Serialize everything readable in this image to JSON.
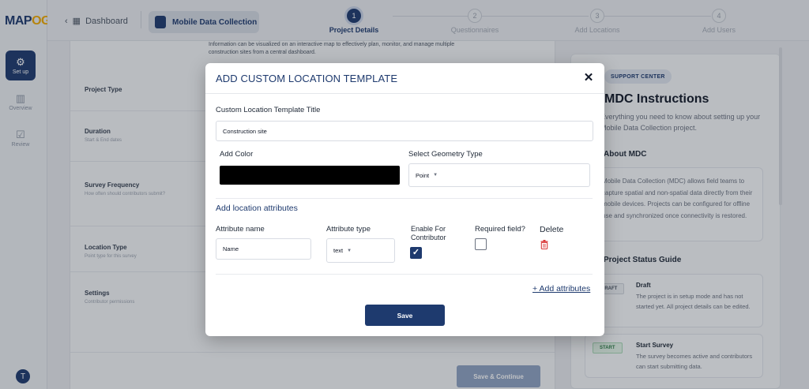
{
  "app": {
    "logo_text": "MAP",
    "logo_accent": "OG",
    "brand_color": "#1e3a6e",
    "accent_color": "#f2a900"
  },
  "rail": {
    "items": [
      {
        "label": "Set up",
        "icon": "gear-icon",
        "active": true
      },
      {
        "label": "Overview",
        "icon": "bar-chart-icon",
        "active": false
      },
      {
        "label": "Review",
        "icon": "check-square-icon",
        "active": false
      }
    ],
    "avatar_initial": "T"
  },
  "topbar": {
    "back_label": "Dashboard",
    "project_label": "Mobile Data Collection",
    "steps": [
      {
        "number": "1",
        "label": "Project Details",
        "active": true
      },
      {
        "number": "2",
        "label": "Questionnaires",
        "active": false
      },
      {
        "number": "3",
        "label": "Add Locations",
        "active": false
      },
      {
        "number": "4",
        "label": "Add Users",
        "active": false
      }
    ]
  },
  "main": {
    "description_line1": "Information can be visualized on an interactive map to effectively plan, monitor, and manage multiple",
    "description_line2": "construction sites from a central dashboard.",
    "rows": [
      {
        "label": "Project Type",
        "sub": ""
      },
      {
        "label": "Duration",
        "sub": "Start & End dates"
      },
      {
        "label": "Survey Frequency",
        "sub": "How often should contributors submit?"
      },
      {
        "label": "Location Type",
        "sub": "Point type for this survey"
      },
      {
        "label": "Settings",
        "sub": "Contributor permissions"
      }
    ],
    "save_continue_label": "Save & Continue"
  },
  "right_panel": {
    "badge": "SUPPORT CENTER",
    "title": "MDC Instructions",
    "subtitle": "Everything you need to know about setting up your Mobile Data Collection project.",
    "about_heading": "About MDC",
    "about_text": "Mobile Data Collection (MDC) allows field teams to capture spatial and non-spatial data directly from their mobile devices. Projects can be configured for offline use and synchronized once connectivity is restored.",
    "status_heading": "Project Status Guide",
    "statuses": [
      {
        "tag": "DRAFT",
        "name": "Draft",
        "desc": "The project is in setup mode and has not started yet. All project details can be edited."
      },
      {
        "tag": "START",
        "name": "Start Survey",
        "desc": "The survey becomes active and contributors can start submitting data."
      }
    ]
  },
  "modal": {
    "title": "ADD CUSTOM LOCATION TEMPLATE",
    "close_glyph": "✕",
    "template_title_label": "Custom Location Template Title",
    "template_title_value": "Construction site",
    "color_label": "Add Color",
    "color_value": "#000000",
    "geometry_label": "Select Geometry Type",
    "geometry_value": "Point",
    "attributes_heading": "Add location attributes",
    "columns": {
      "name": "Attribute name",
      "type": "Attribute type",
      "enable": "Enable For Contributor",
      "required": "Required field?",
      "delete": "Delete"
    },
    "attribute_row": {
      "name": "Name",
      "type": "text",
      "enabled": true,
      "required": false
    },
    "add_attributes_label": "+ Add attributes",
    "save_label": "Save"
  }
}
